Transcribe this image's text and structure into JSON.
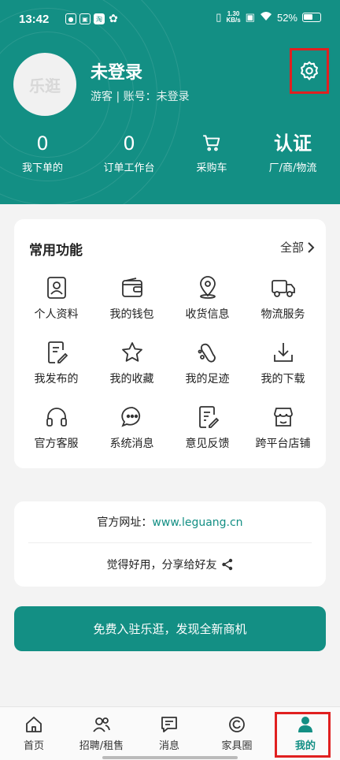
{
  "status_bar": {
    "time": "13:42",
    "speed": "1.30",
    "speed_unit": "KB/s",
    "battery": "52%"
  },
  "profile": {
    "avatar_text": "乐逛",
    "name": "未登录",
    "subtitle": "游客 | 账号：未登录"
  },
  "stats": [
    {
      "value": "0",
      "label": "我下单的"
    },
    {
      "value": "0",
      "label": "订单工作台"
    },
    {
      "value": "",
      "label": "采购车",
      "icon": "cart-icon"
    },
    {
      "value": "认证",
      "label": "厂/商/物流"
    }
  ],
  "functions": {
    "title": "常用功能",
    "all_label": "全部",
    "items": [
      {
        "label": "个人资料",
        "icon": "profile-card-icon"
      },
      {
        "label": "我的钱包",
        "icon": "wallet-icon"
      },
      {
        "label": "收货信息",
        "icon": "location-pin-icon"
      },
      {
        "label": "物流服务",
        "icon": "truck-icon"
      },
      {
        "label": "我发布的",
        "icon": "edit-document-icon"
      },
      {
        "label": "我的收藏",
        "icon": "star-icon"
      },
      {
        "label": "我的足迹",
        "icon": "footprint-icon"
      },
      {
        "label": "我的下载",
        "icon": "download-icon"
      },
      {
        "label": "官方客服",
        "icon": "headset-icon"
      },
      {
        "label": "系统消息",
        "icon": "chat-bubble-icon"
      },
      {
        "label": "意见反馈",
        "icon": "feedback-icon"
      },
      {
        "label": "跨平台店铺",
        "icon": "store-icon"
      }
    ]
  },
  "info": {
    "site_label": "官方网址：",
    "site_url": "www.leguang.cn",
    "share_text": "觉得好用，分享给好友"
  },
  "join_button": "免费入驻乐逛，发现全新商机",
  "tabs": [
    {
      "label": "首页",
      "icon": "home-icon"
    },
    {
      "label": "招聘/租售",
      "icon": "people-icon"
    },
    {
      "label": "消息",
      "icon": "message-icon"
    },
    {
      "label": "家具圈",
      "icon": "circle-icon"
    },
    {
      "label": "我的",
      "icon": "user-icon",
      "active": true
    }
  ],
  "colors": {
    "brand": "#138f84",
    "highlight": "#e02020"
  }
}
